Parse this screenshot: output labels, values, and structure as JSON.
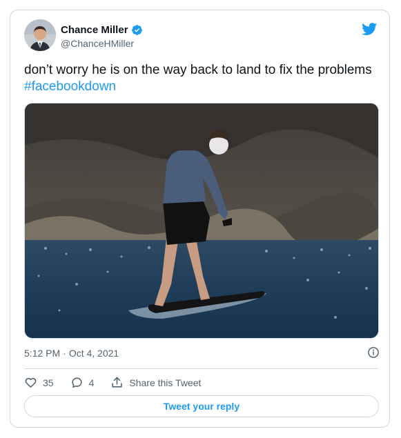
{
  "tweet": {
    "author": {
      "name": "Chance Miller",
      "handle": "@ChanceHMiller",
      "verified": true
    },
    "text": "don’t worry he is on the way back to land to fix the problems ",
    "hashtag": "#facebookdown",
    "time": "5:12 PM",
    "separator": "·",
    "date": "Oct 4, 2021"
  },
  "actions": {
    "likes": "35",
    "replies": "4",
    "share_label": "Share this Tweet"
  },
  "reply_button": {
    "label": "Tweet your reply"
  },
  "colors": {
    "accent": "#1d9bf0",
    "text": "#0f1419",
    "secondary": "#536471",
    "border": "#cfd9de"
  },
  "icons": [
    "verified-badge-icon",
    "twitter-bird-icon",
    "info-icon",
    "heart-icon",
    "reply-icon",
    "share-icon"
  ]
}
